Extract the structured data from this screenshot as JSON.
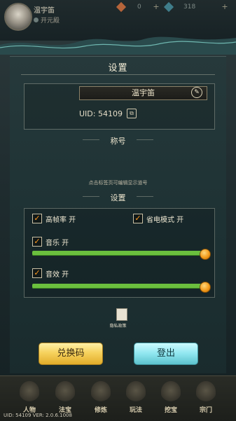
{
  "profile": {
    "top_name": "温宇笛",
    "sect": "开元殿",
    "resource_1": "0",
    "resource_2": "318",
    "panel_title": "设置",
    "display_name": "温宇笛",
    "uid_label": "UID: 54109"
  },
  "titles": {
    "section_label": "称号",
    "hint": "点击标签页可编辑显示道号"
  },
  "settings": {
    "section_label": "设置",
    "high_fps": "高帧率 开",
    "power_save": "省电模式 开",
    "music": "音乐 开",
    "sfx": "音效 开",
    "music_level": 1.0,
    "sfx_level": 1.0
  },
  "privacy": {
    "label": "隐私政策"
  },
  "buttons": {
    "redeem": "兑换码",
    "logout": "登出"
  },
  "nav": [
    "人物",
    "法宝",
    "修炼",
    "玩法",
    "挖宝",
    "宗门"
  ],
  "version": "UID: 54109  VER: 2.0.6.1008",
  "colors": {
    "accent_orange": "#f29b1c",
    "slider_green": "#6bbf3e",
    "redeem_yellow": "#f6d25e",
    "logout_cyan": "#8fe6ef"
  }
}
